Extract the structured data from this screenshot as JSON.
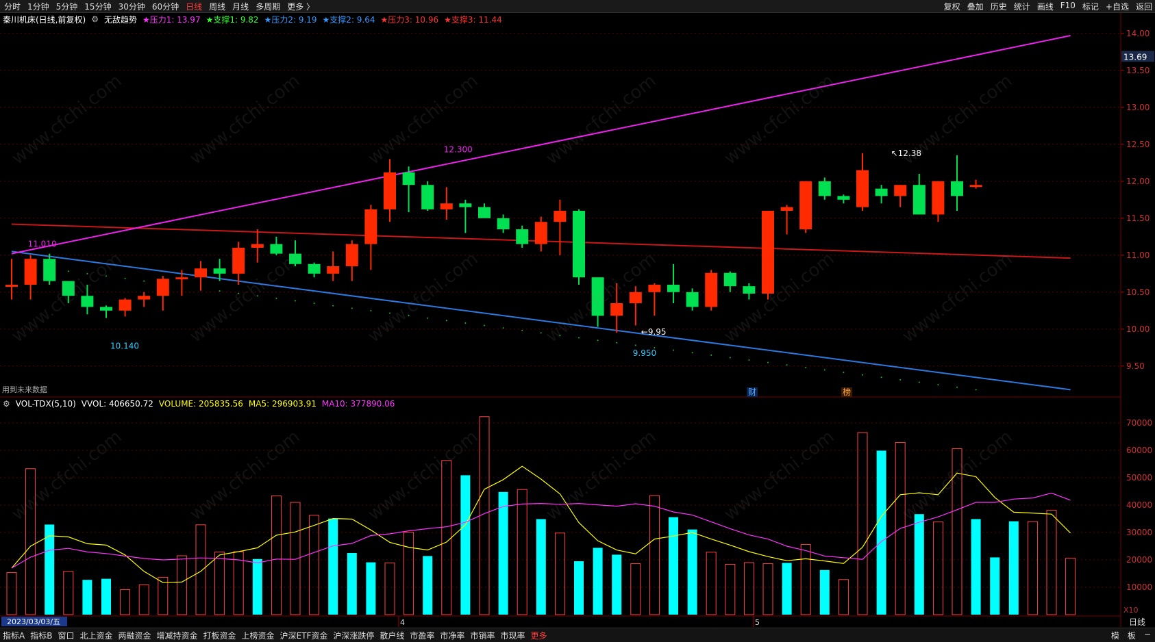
{
  "topbar": {
    "tabs": [
      {
        "label": "分时",
        "active": false
      },
      {
        "label": "1分钟",
        "active": false
      },
      {
        "label": "5分钟",
        "active": false
      },
      {
        "label": "15分钟",
        "active": false
      },
      {
        "label": "30分钟",
        "active": false
      },
      {
        "label": "60分钟",
        "active": false
      },
      {
        "label": "日线",
        "active": true
      },
      {
        "label": "周线",
        "active": false
      },
      {
        "label": "月线",
        "active": false
      },
      {
        "label": "多周期",
        "active": false
      },
      {
        "label": "更多 〉",
        "active": false
      }
    ],
    "right_tools": [
      "复权",
      "叠加",
      "历史",
      "统计",
      "画线",
      "F10",
      "标记",
      "+自选",
      "返回"
    ]
  },
  "info": {
    "stock": "秦川机床(日线,前复权)",
    "indicator": "无敌趋势",
    "items": [
      {
        "text": "★压力1: 13.97",
        "color": "#ff33ff"
      },
      {
        "text": "★支撑1: 9.82",
        "color": "#33ff33"
      },
      {
        "text": "★压力2: 9.19",
        "color": "#3399ff"
      },
      {
        "text": "★支撑2: 9.64",
        "color": "#3399ff"
      },
      {
        "text": "★压力3: 10.96",
        "color": "#ff3333"
      },
      {
        "text": "★支撑3: 11.44",
        "color": "#ff3333"
      }
    ],
    "future_note": "用到未来数据"
  },
  "vol_info": {
    "name": "VOL-TDX(5,10)",
    "vvol": "VVOL: 406650.72",
    "volume": "VOLUME: 205835.56",
    "ma5": "MA5: 296903.91",
    "ma10": "MA10: 377890.06"
  },
  "price_axis": {
    "ticks": [
      "14.00",
      "13.50",
      "13.00",
      "12.50",
      "12.00",
      "11.50",
      "11.00",
      "10.50",
      "10.00",
      "9.50"
    ],
    "current_price": "13.69"
  },
  "vol_axis": {
    "ticks": [
      "70000",
      "60000",
      "50000",
      "40000",
      "30000",
      "20000",
      "10000"
    ],
    "unit": "X10"
  },
  "date_axis": {
    "first_date": "2023/03/03/五",
    "months": [
      "4",
      "5"
    ]
  },
  "annotations": {
    "high1": "12.300",
    "high2": "12.38",
    "low1": "10.140",
    "low2": "9.950",
    "low2_arrow": "9.95",
    "left_high": "11.010",
    "event1": "财",
    "event2": "榜"
  },
  "colors": {
    "up": "#ff2a00",
    "down": "#00e050",
    "vol_down": "#00ffff",
    "vol_up": "#ff4444",
    "ma5": "#ffff00",
    "ma10": "#ff33ff"
  },
  "chart_data": {
    "type": "candlestick",
    "ohlc": [
      [
        10.6,
        10.95,
        10.4,
        10.6
      ],
      [
        10.6,
        11.0,
        10.4,
        10.95
      ],
      [
        10.95,
        11.02,
        10.6,
        10.65
      ],
      [
        10.65,
        10.62,
        10.35,
        10.45
      ],
      [
        10.45,
        10.6,
        10.2,
        10.3
      ],
      [
        10.3,
        10.32,
        10.15,
        10.25
      ],
      [
        10.25,
        10.42,
        10.17,
        10.4
      ],
      [
        10.4,
        10.5,
        10.3,
        10.45
      ],
      [
        10.45,
        10.72,
        10.25,
        10.68
      ],
      [
        10.68,
        10.8,
        10.45,
        10.7
      ],
      [
        10.7,
        10.92,
        10.52,
        10.82
      ],
      [
        10.82,
        10.95,
        10.65,
        10.75
      ],
      [
        10.75,
        11.18,
        10.6,
        11.1
      ],
      [
        11.1,
        11.35,
        10.9,
        11.15
      ],
      [
        11.15,
        11.25,
        11.0,
        11.02
      ],
      [
        11.02,
        11.2,
        10.85,
        10.88
      ],
      [
        10.88,
        10.9,
        10.7,
        10.75
      ],
      [
        10.75,
        11.05,
        10.65,
        10.85
      ],
      [
        10.85,
        11.2,
        10.65,
        11.15
      ],
      [
        11.15,
        11.68,
        10.8,
        11.62
      ],
      [
        11.62,
        12.3,
        11.45,
        12.12
      ],
      [
        12.12,
        12.2,
        11.58,
        11.95
      ],
      [
        11.95,
        12.0,
        11.6,
        11.62
      ],
      [
        11.62,
        11.92,
        11.48,
        11.7
      ],
      [
        11.7,
        11.75,
        11.3,
        11.65
      ],
      [
        11.65,
        11.7,
        11.55,
        11.5
      ],
      [
        11.5,
        11.55,
        11.3,
        11.35
      ],
      [
        11.35,
        11.4,
        11.1,
        11.15
      ],
      [
        11.15,
        11.52,
        11.05,
        11.45
      ],
      [
        11.45,
        11.75,
        11.0,
        11.6
      ],
      [
        11.6,
        11.62,
        10.6,
        10.7
      ],
      [
        10.7,
        10.65,
        10.03,
        10.18
      ],
      [
        10.18,
        10.62,
        9.95,
        10.35
      ],
      [
        10.35,
        10.58,
        10.05,
        10.5
      ],
      [
        10.5,
        10.62,
        10.18,
        10.6
      ],
      [
        10.6,
        10.88,
        10.35,
        10.5
      ],
      [
        10.5,
        10.55,
        10.25,
        10.3
      ],
      [
        10.3,
        10.8,
        10.25,
        10.76
      ],
      [
        10.76,
        10.78,
        10.5,
        10.58
      ],
      [
        10.58,
        10.62,
        10.4,
        10.48
      ],
      [
        10.48,
        11.6,
        10.4,
        11.6
      ],
      [
        11.6,
        11.68,
        11.28,
        11.65
      ],
      [
        11.35,
        12.0,
        11.3,
        12.0
      ],
      [
        12.0,
        12.05,
        11.75,
        11.8
      ],
      [
        11.8,
        11.82,
        11.7,
        11.75
      ],
      [
        11.65,
        12.38,
        11.6,
        12.15
      ],
      [
        11.9,
        11.95,
        11.7,
        11.8
      ],
      [
        11.8,
        11.95,
        11.65,
        11.95
      ],
      [
        11.95,
        12.1,
        11.62,
        11.55
      ],
      [
        11.55,
        12.0,
        11.45,
        12.0
      ],
      [
        12.0,
        12.35,
        11.6,
        11.8
      ],
      [
        11.95,
        12.02,
        11.9,
        11.95
      ]
    ],
    "volume": [
      15400,
      53300,
      32900,
      15800,
      12700,
      13100,
      9100,
      10900,
      13600,
      21500,
      32800,
      22900,
      23000,
      20300,
      43400,
      41000,
      36300,
      35100,
      22500,
      19100,
      18900,
      30100,
      21400,
      56300,
      50900,
      72300,
      44800,
      45700,
      34900,
      29800,
      19500,
      24400,
      21900,
      18600,
      43500,
      35600,
      31100,
      22800,
      18400,
      19000,
      18600,
      18900,
      25600,
      16300,
      12800,
      66500,
      59900,
      62900,
      36700,
      33900,
      60600,
      34900,
      20900,
      34100,
      34000,
      38100,
      20600
    ],
    "volume_up": [
      true,
      true,
      false,
      true,
      false,
      false,
      true,
      true,
      true,
      true,
      true,
      true,
      true,
      false,
      true,
      true,
      true,
      false,
      false,
      false,
      true,
      true,
      false,
      true,
      false,
      true,
      false,
      true,
      false,
      true,
      false,
      false,
      false,
      true,
      true,
      false,
      false,
      true,
      true,
      true,
      true,
      false,
      true,
      false,
      true,
      true,
      false,
      true,
      false,
      true,
      true,
      false,
      false,
      false,
      true,
      true,
      true
    ],
    "ma5": [
      17000,
      25000,
      28800,
      28400,
      25900,
      25400,
      21800,
      15800,
      11700,
      11900,
      15800,
      21800,
      23000,
      24400,
      29000,
      30200,
      32600,
      35100,
      34900,
      30900,
      26400,
      24600,
      23600,
      26500,
      32800,
      45800,
      49300,
      54200,
      49500,
      44100,
      33600,
      27000,
      23600,
      22200,
      27600,
      28700,
      30000,
      27600,
      25400,
      23000,
      21200,
      19700,
      20400,
      19600,
      18700,
      24600,
      35900,
      43800,
      44500,
      43800,
      51700,
      50400,
      42800,
      37400,
      37100,
      36700,
      29800
    ],
    "ma10": [
      17000,
      21000,
      23500,
      24200,
      22900,
      22300,
      21400,
      20500,
      20000,
      20300,
      20700,
      20500,
      20000,
      18900,
      20300,
      20200,
      22700,
      25100,
      26000,
      28900,
      29500,
      30600,
      31400,
      32100,
      33700,
      36900,
      39500,
      40400,
      40600,
      40300,
      40600,
      40100,
      39600,
      40500,
      39600,
      37500,
      36400,
      33900,
      31400,
      29100,
      27600,
      25000,
      23400,
      21400,
      20800,
      20200,
      26700,
      31500,
      33700,
      35700,
      38300,
      41000,
      41000,
      42200,
      42600,
      44400,
      41800
    ],
    "trend_lines": {
      "pressure_magenta": {
        "from": [
          0,
          11.02
        ],
        "to": [
          56,
          13.97
        ]
      },
      "support_blue": {
        "from": [
          0,
          11.05
        ],
        "to": [
          56,
          9.18
        ]
      },
      "mid_red": {
        "from": [
          0,
          11.42
        ],
        "to": [
          56,
          10.96
        ]
      }
    },
    "ylim_price": [
      9.1,
      14.1
    ],
    "ylim_volume": [
      0,
      75000
    ]
  },
  "bottombar": {
    "tabs": [
      "指标A",
      "指标B",
      "窗口",
      "北上资金",
      "两融资金",
      "增减持资金",
      "打板资金",
      "上榜资金",
      "沪深ETF资金",
      "沪深涨跌停",
      "散户线",
      "市盈率",
      "市净率",
      "市销率",
      "市现率",
      "更多"
    ],
    "right": [
      "模",
      "板",
      "−"
    ]
  }
}
